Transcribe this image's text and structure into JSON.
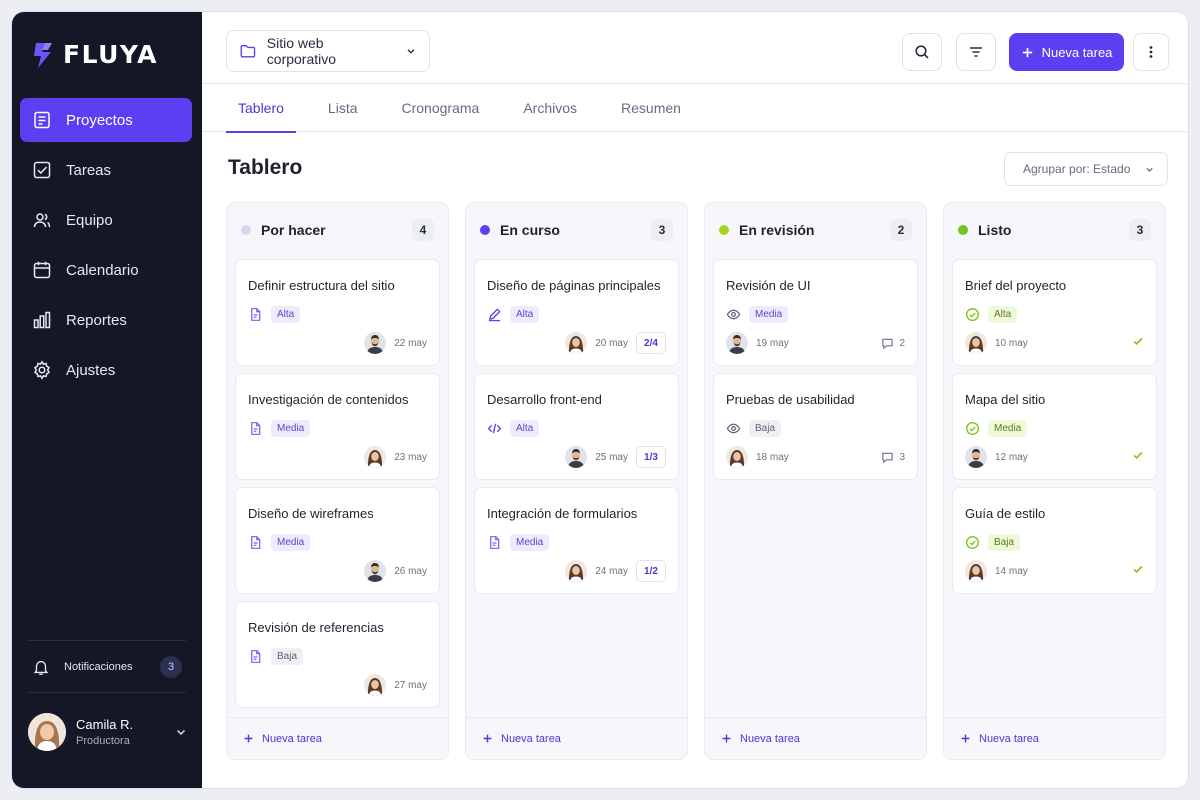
{
  "app": {
    "logo_text": "FLUYA",
    "accent": "#5b3ff0"
  },
  "sidebar": {
    "items": [
      {
        "label": "Proyectos",
        "icon": "projects-icon",
        "active": true
      },
      {
        "label": "Tareas",
        "icon": "tasks-check-icon"
      },
      {
        "label": "Equipo",
        "icon": "team-icon"
      },
      {
        "label": "Calendario",
        "icon": "calendar-icon"
      },
      {
        "label": "Reportes",
        "icon": "bar-chart-icon"
      },
      {
        "label": "Ajustes",
        "icon": "gear-icon"
      }
    ],
    "notifications": {
      "label": "Notificaciones",
      "count": "3"
    },
    "user": {
      "name": "Camila R.",
      "role": "Productora"
    }
  },
  "header": {
    "project": "Sitio web corporativo",
    "new_task_button": "Nueva tarea"
  },
  "tabs": [
    "Tablero",
    "Lista",
    "Cronograma",
    "Archivos",
    "Resumen"
  ],
  "board": {
    "title": "Tablero",
    "group_by": "Agrupar por: Estado",
    "add_task_label": "Nueva tarea",
    "columns": [
      {
        "title": "Por hacer",
        "count": "4",
        "color": "#d9d7f0",
        "cards": [
          {
            "title": "Definir estructura del sitio",
            "icon": "document-icon",
            "priority": "Alta",
            "date": "22 may",
            "avatar": "man"
          },
          {
            "title": "Investigación de contenidos",
            "icon": "document-icon",
            "priority": "Media",
            "date": "23 may",
            "avatar": "woman"
          },
          {
            "title": "Diseño de wireframes",
            "icon": "document-icon",
            "priority": "Media",
            "date": "26 may",
            "avatar": "man"
          },
          {
            "title": "Revisión de referencias",
            "icon": "document-icon",
            "priority": "Baja",
            "date": "27 may",
            "avatar": "woman"
          }
        ]
      },
      {
        "title": "En curso",
        "count": "3",
        "color": "#5b3ff0",
        "cards": [
          {
            "title": "Diseño de páginas principales",
            "icon": "pencil-icon",
            "priority": "Alta",
            "date": "20 may",
            "avatar": "woman",
            "subtasks": "2/4"
          },
          {
            "title": "Desarrollo front-end",
            "icon": "code-icon",
            "priority": "Alta",
            "date": "25 may",
            "avatar": "man",
            "subtasks": "1/3"
          },
          {
            "title": "Integración de formularios",
            "icon": "document-icon",
            "priority": "Media",
            "date": "24 may",
            "avatar": "woman",
            "subtasks": "1/2"
          }
        ]
      },
      {
        "title": "En revisión",
        "count": "2",
        "color": "#a3d321",
        "cards": [
          {
            "title": "Revisión de UI",
            "icon": "eye-icon",
            "priority": "Media",
            "date": "19 may",
            "avatar": "man",
            "comments": "2"
          },
          {
            "title": "Pruebas de usabilidad",
            "icon": "eye-icon",
            "priority": "Baja",
            "date": "18 may",
            "avatar": "woman",
            "comments": "3"
          }
        ]
      },
      {
        "title": "Listo",
        "count": "3",
        "color": "#6cc61f",
        "cards": [
          {
            "title": "Brief del proyecto",
            "icon": "check-circle-icon",
            "priority": "Alta",
            "date": "10 may",
            "avatar": "woman",
            "done": true
          },
          {
            "title": "Mapa del sitio",
            "icon": "check-circle-icon",
            "priority": "Media",
            "date": "12 may",
            "avatar": "man",
            "done": true
          },
          {
            "title": "Guía de estilo",
            "icon": "check-circle-icon",
            "priority": "Baja",
            "date": "14 may",
            "avatar": "woman",
            "done": true
          }
        ]
      }
    ]
  }
}
